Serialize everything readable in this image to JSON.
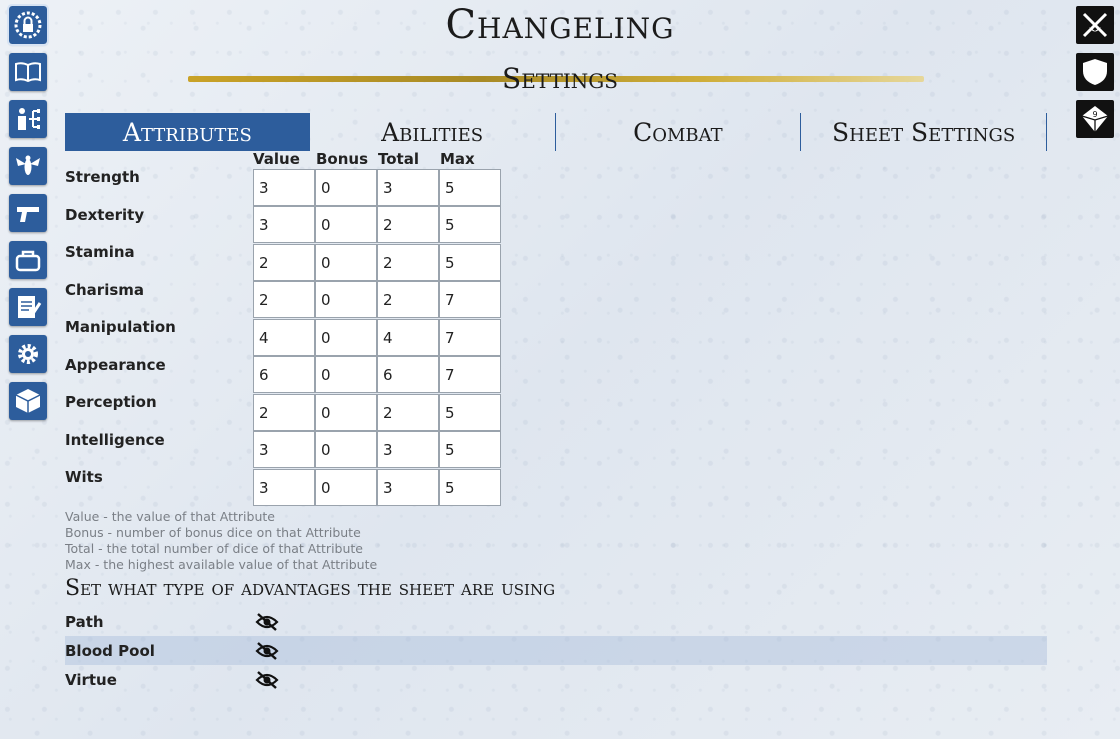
{
  "header": {
    "title": "Changeling",
    "subtitle": "Settings"
  },
  "left_nav": [
    {
      "icon": "lock-icon"
    },
    {
      "icon": "book-icon"
    },
    {
      "icon": "person-tree-icon"
    },
    {
      "icon": "wasp-icon"
    },
    {
      "icon": "pistol-icon"
    },
    {
      "icon": "bag-icon"
    },
    {
      "icon": "notepad-icon"
    },
    {
      "icon": "gear-icon"
    },
    {
      "icon": "dice-icon"
    }
  ],
  "right_nav": [
    {
      "icon": "crossed-swords-icon"
    },
    {
      "icon": "shield-icon"
    },
    {
      "icon": "d10-icon"
    }
  ],
  "tabs": [
    {
      "label": "Attributes",
      "active": true
    },
    {
      "label": "Abilities"
    },
    {
      "label": "Combat"
    },
    {
      "label": "Sheet Settings"
    }
  ],
  "columns": [
    "Value",
    "Bonus",
    "Total",
    "Max"
  ],
  "attributes": [
    {
      "name": "Strength",
      "value": "3",
      "bonus": "0",
      "total": "3",
      "max": "5"
    },
    {
      "name": "Dexterity",
      "value": "3",
      "bonus": "0",
      "total": "2",
      "max": "5"
    },
    {
      "name": "Stamina",
      "value": "2",
      "bonus": "0",
      "total": "2",
      "max": "5"
    },
    {
      "name": "Charisma",
      "value": "2",
      "bonus": "0",
      "total": "2",
      "max": "7"
    },
    {
      "name": "Manipulation",
      "value": "4",
      "bonus": "0",
      "total": "4",
      "max": "7"
    },
    {
      "name": "Appearance",
      "value": "6",
      "bonus": "0",
      "total": "6",
      "max": "7"
    },
    {
      "name": "Perception",
      "value": "2",
      "bonus": "0",
      "total": "2",
      "max": "5"
    },
    {
      "name": "Intelligence",
      "value": "3",
      "bonus": "0",
      "total": "3",
      "max": "5"
    },
    {
      "name": "Wits",
      "value": "3",
      "bonus": "0",
      "total": "3",
      "max": "5"
    }
  ],
  "legend": [
    "Value - the value of that Attribute",
    "Bonus - number of bonus dice on that Attribute",
    "Total - the total number of dice of that Attribute",
    "Max - the highest available value of that Attribute"
  ],
  "advantages": {
    "title": "Set what type of advantages the sheet are using",
    "items": [
      {
        "label": "Path",
        "icon": "eye-off-icon"
      },
      {
        "label": "Blood Pool",
        "icon": "eye-off-icon"
      },
      {
        "label": "Virtue",
        "icon": "eye-off-icon"
      }
    ]
  },
  "colors": {
    "accent": "#2d5d9c",
    "gold": "#c9a227"
  }
}
